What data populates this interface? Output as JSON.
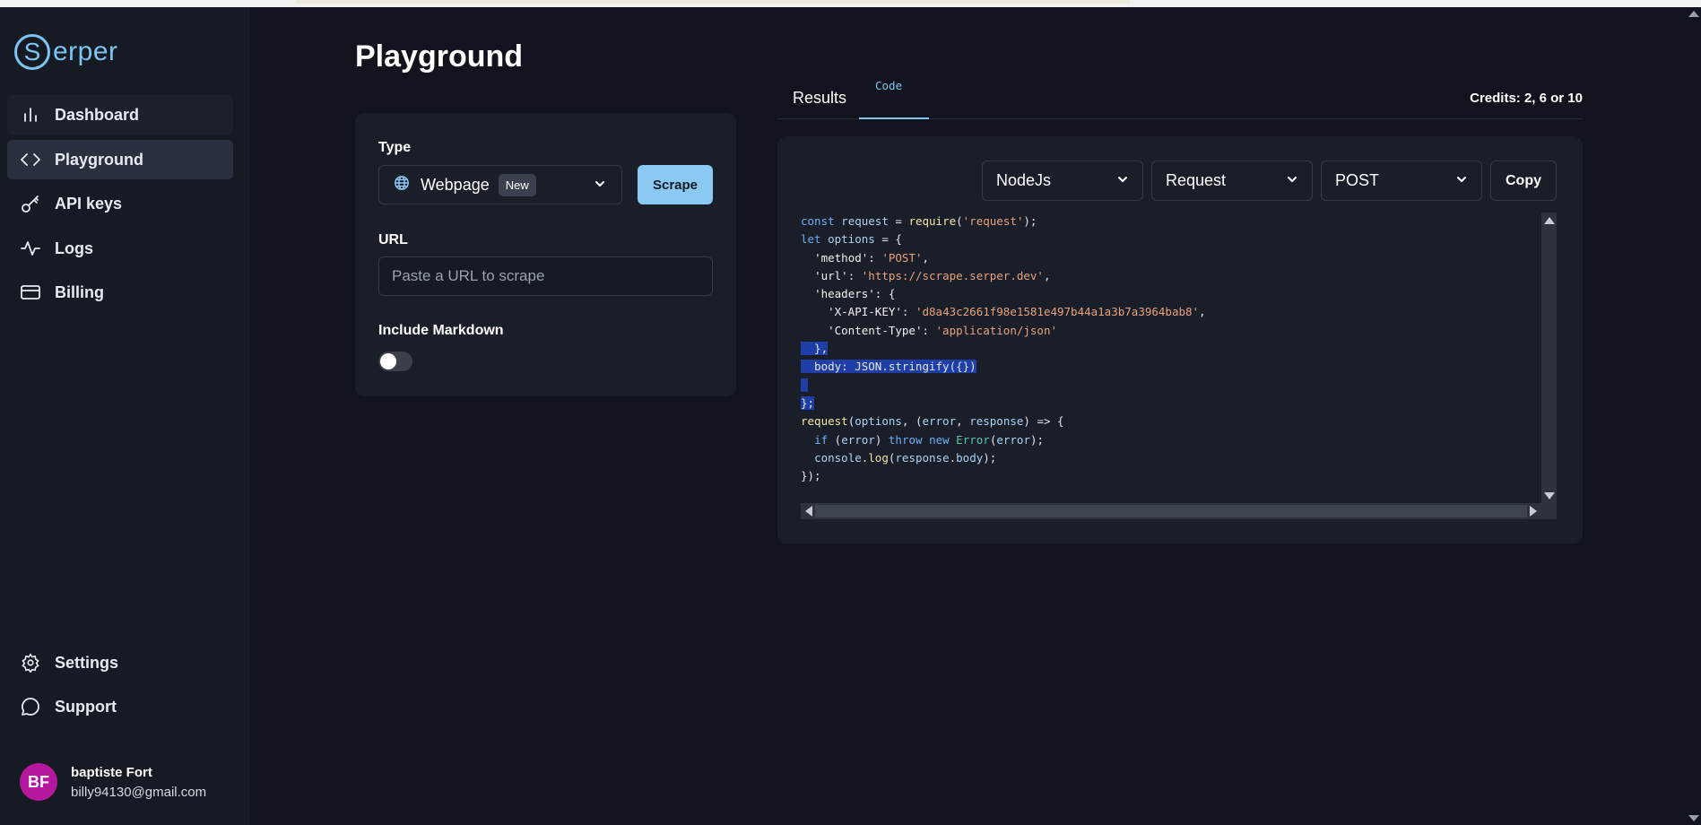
{
  "brand": {
    "logo_letter": "S",
    "logo_word": "erper",
    "accent": "#7cc4f1"
  },
  "sidebar": {
    "items": [
      {
        "label": "Dashboard",
        "icon": "bar-chart-icon",
        "state": "hover"
      },
      {
        "label": "Playground",
        "icon": "code-icon",
        "state": "active"
      },
      {
        "label": "API keys",
        "icon": "key-icon",
        "state": "normal"
      },
      {
        "label": "Logs",
        "icon": "activity-icon",
        "state": "normal"
      },
      {
        "label": "Billing",
        "icon": "credit-card-icon",
        "state": "normal"
      }
    ],
    "bottom_items": [
      {
        "label": "Settings",
        "icon": "gear-icon"
      },
      {
        "label": "Support",
        "icon": "chat-bubble-icon"
      }
    ],
    "user": {
      "initials": "BF",
      "name": "baptiste Fort",
      "email": "billy94130@gmail.com",
      "avatar_color": "#b5179e"
    }
  },
  "main": {
    "title": "Playground",
    "form": {
      "type_label": "Type",
      "type_value": "Webpage",
      "type_badge": "New",
      "scrape_label": "Scrape",
      "url_label": "URL",
      "url_placeholder": "Paste a URL to scrape",
      "url_value": "",
      "markdown_label": "Include Markdown",
      "markdown_enabled": false
    },
    "tabs": [
      {
        "label": "Results",
        "active": false
      },
      {
        "label": "Code",
        "active": true
      }
    ],
    "credits": "Credits: 2, 6 or 10",
    "code_panel": {
      "language": "NodeJs",
      "library": "Request",
      "method": "POST",
      "copy_label": "Copy"
    }
  }
}
